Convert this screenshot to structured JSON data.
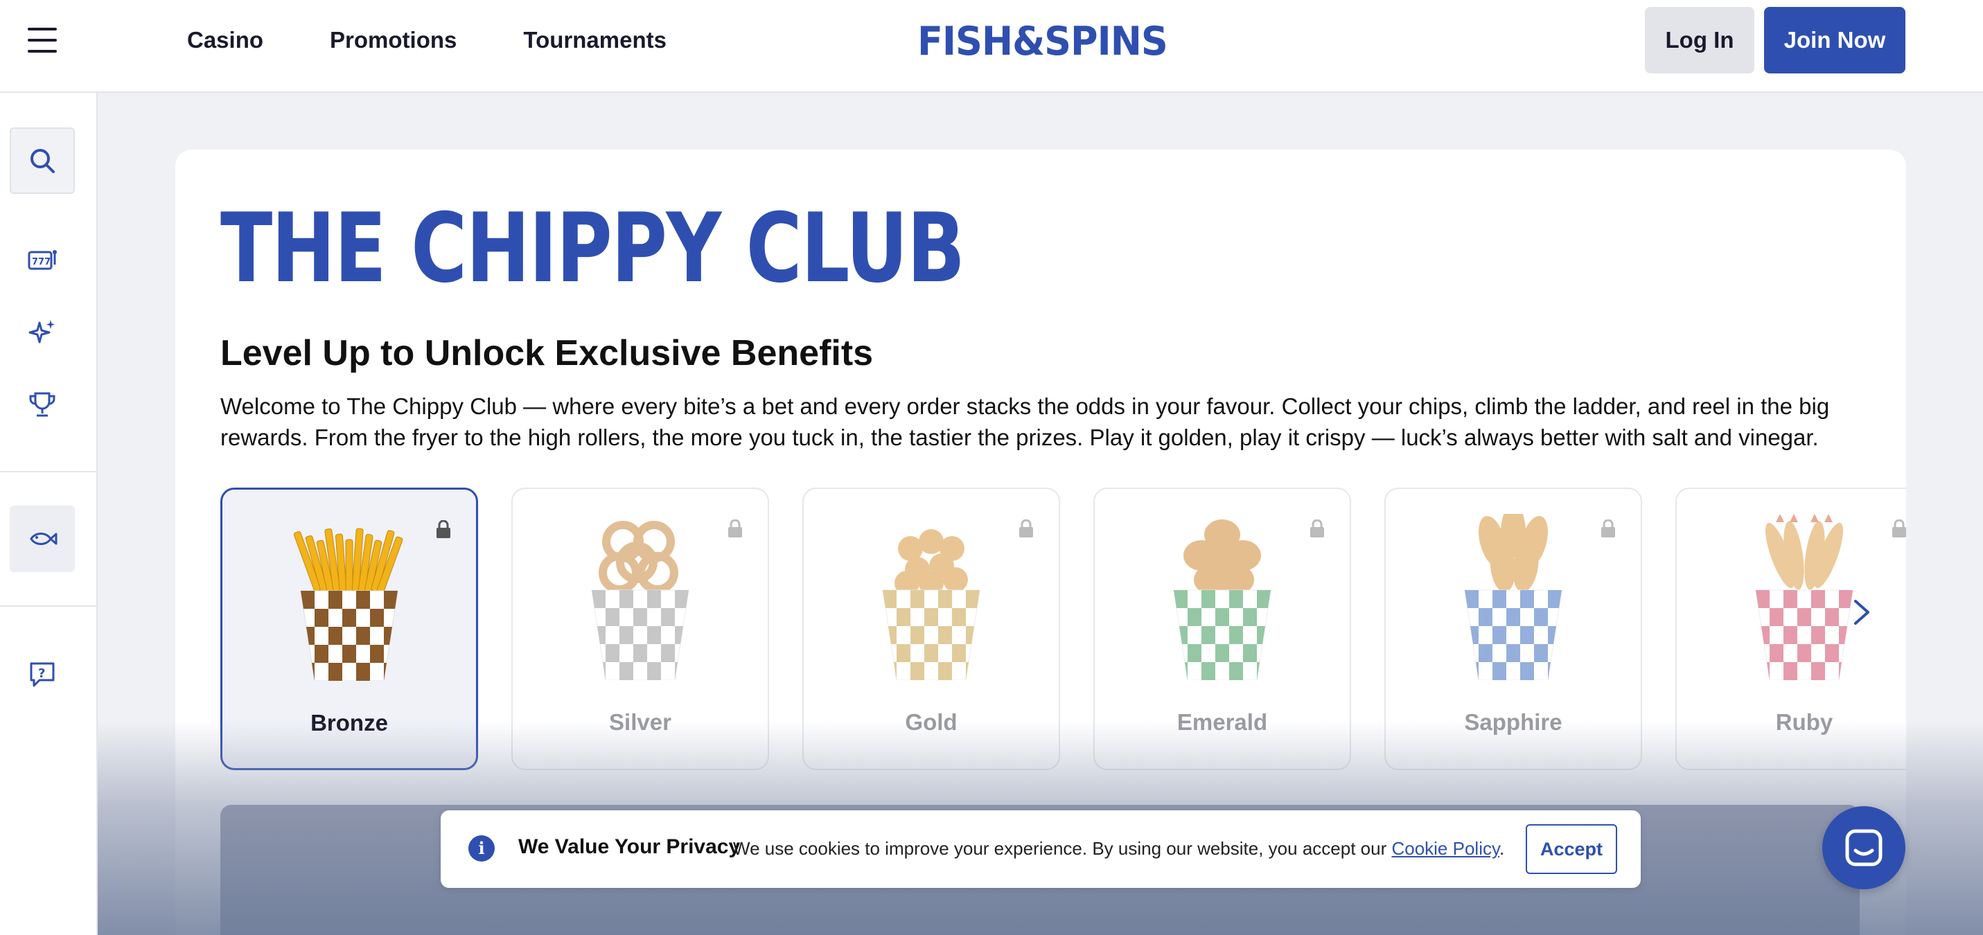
{
  "header": {
    "nav": [
      "Casino",
      "Promotions",
      "Tournaments"
    ],
    "logo_text": "FISH&SPINS",
    "login_label": "Log In",
    "join_label": "Join Now",
    "menu_icon": "hamburger-menu-icon"
  },
  "sidebar": {
    "items": [
      {
        "icon": "search-icon"
      },
      {
        "icon": "slot-machine-icon"
      },
      {
        "icon": "sparkles-icon"
      },
      {
        "icon": "trophy-icon"
      },
      {
        "icon": "fish-icon"
      },
      {
        "icon": "help-chat-icon"
      }
    ]
  },
  "club": {
    "title": "THE CHIPPY CLUB",
    "subtitle": "Level Up to Unlock Exclusive Benefits",
    "description": "Welcome to The Chippy Club — where every bite’s a bet and every order stacks the odds in your favour. Collect your chips, climb the ladder, and reel in the big rewards. From the fryer to the high rollers, the more you tuck in, the tastier the prizes. Play it golden, play it crispy — luck’s always better with salt and vinegar."
  },
  "tiers": [
    {
      "name": "Bronze",
      "food": "fries",
      "check_color": "#8a5a2b",
      "active": true
    },
    {
      "name": "Silver",
      "food": "onion-rings",
      "check_color": "#9a9a9a",
      "active": false
    },
    {
      "name": "Gold",
      "food": "popcorn-bites",
      "check_color": "#c9a24a",
      "active": false
    },
    {
      "name": "Emerald",
      "food": "nuggets",
      "check_color": "#3f9a5a",
      "active": false
    },
    {
      "name": "Sapphire",
      "food": "tenders",
      "check_color": "#3f6fc0",
      "active": false
    },
    {
      "name": "Ruby",
      "food": "shrimp",
      "check_color": "#d04a6a",
      "active": false
    }
  ],
  "cookie": {
    "title": "We Value Your Privacy",
    "text": "We use cookies to improve your experience. By using our website, you accept our ",
    "link": "Cookie Policy",
    "after": ".",
    "accept_label": "Accept"
  },
  "colors": {
    "brand": "#2f4fb0",
    "background": "#f0f1f5"
  }
}
